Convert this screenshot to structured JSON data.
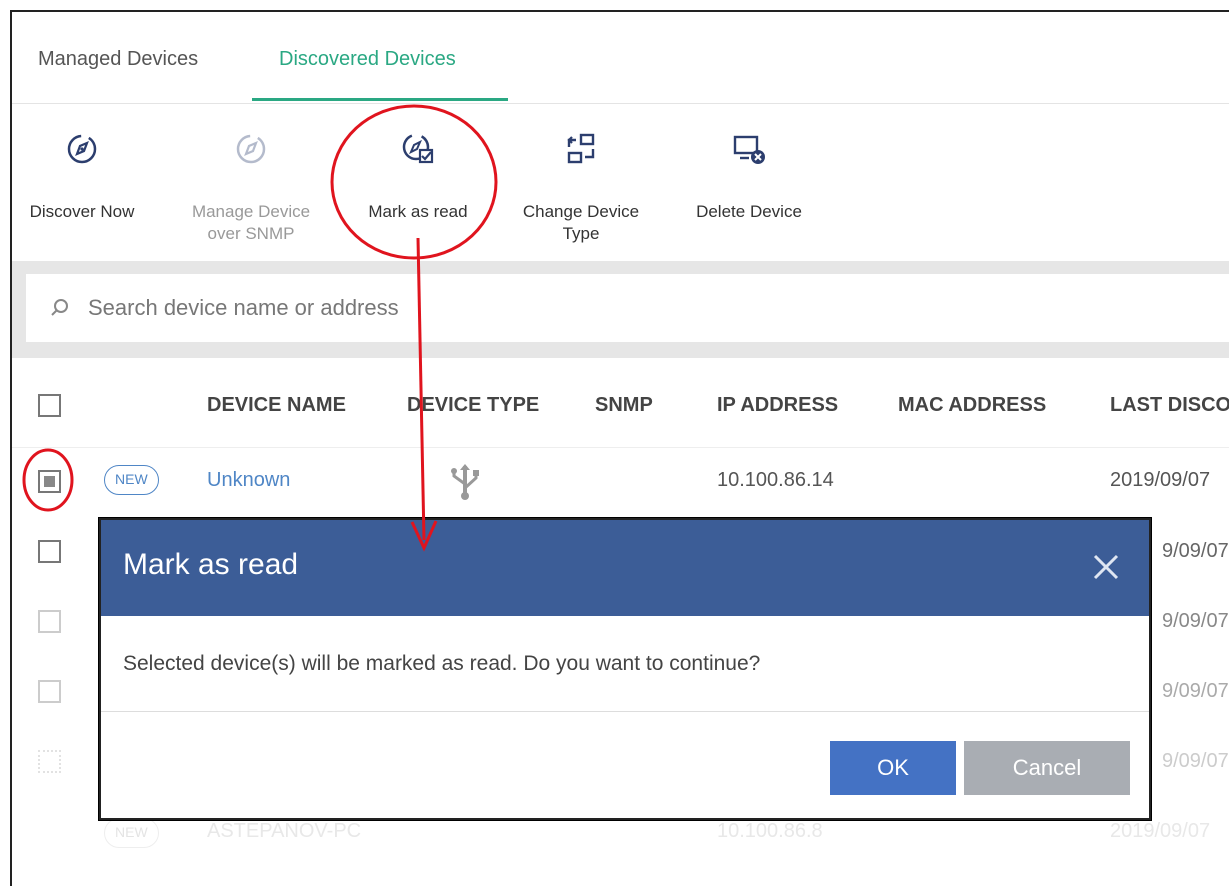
{
  "tabs": {
    "managed_label": "Managed Devices",
    "discovered_label": "Discovered Devices",
    "accent_color": "#2aa883"
  },
  "toolbar": {
    "discover_now": "Discover Now",
    "manage_snmp_line1": "Manage Device",
    "manage_snmp_line2": "over SNMP",
    "mark_as_read": "Mark as read",
    "change_type_line1": "Change Device",
    "change_type_line2": "Type",
    "delete_device": "Delete Device"
  },
  "search": {
    "placeholder": "Search device name or address"
  },
  "table": {
    "headers": {
      "device_name": "DEVICE NAME",
      "device_type": "DEVICE TYPE",
      "snmp": "SNMP",
      "ip_address": "IP ADDRESS",
      "mac_address": "MAC ADDRESS",
      "last_discovered": "LAST DISCO"
    },
    "rows": [
      {
        "badge": "NEW",
        "name": "Unknown",
        "device_type_icon": "usb-icon",
        "ip": "10.100.86.14",
        "last_discovered": "2019/09/07",
        "checked": true
      },
      {
        "last_discovered": "9/09/07"
      },
      {
        "last_discovered": "9/09/07"
      },
      {
        "last_discovered": "9/09/07"
      },
      {
        "last_discovered": "9/09/07"
      },
      {
        "badge": "NEW",
        "name": "ASTEPANOV-PC",
        "ip": "10.100.86.8",
        "last_discovered": "2019/09/07"
      }
    ]
  },
  "dialog": {
    "title": "Mark as read",
    "message": "Selected device(s) will be marked as read. Do you want to continue?",
    "ok_label": "OK",
    "cancel_label": "Cancel",
    "header_color": "#3c5d97"
  },
  "annotation_color": "#e0141e"
}
